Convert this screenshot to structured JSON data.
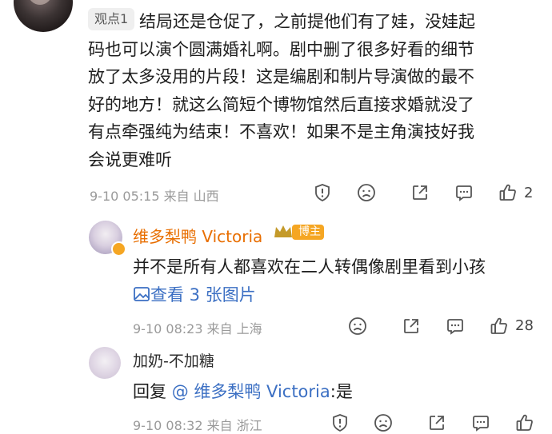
{
  "comment": {
    "badge": "观点1",
    "text": "结局还是仓促了，之前提他们有了娃，没娃起码也可以演个圆满婚礼啊。剧中删了很多好看的细节放了太多没用的片段！这是编剧和制片导演做的最不好的地方！就这么简短个博物馆然后直接求婚就没了有点牵强纯为结束！不喜欢！如果不是主角演技好我会说更难听",
    "lines": [
      "结局还是仓促了，之前提他们有了娃，没娃起",
      "码也可以演个圆满婚礼啊。剧中删了很多好看的细节",
      "放了太多没用的片段！这是编剧和制片导演做的最不",
      "好的地方！就这么简短个博物馆然后直接求婚就没了",
      "有点牵强纯为结束！不喜欢！如果不是主角演技好我",
      "会说更难听"
    ],
    "meta": "9-10 05:15  来自 山西",
    "like_count": "2"
  },
  "replies": [
    {
      "username": "维多梨鸭 Victoria",
      "role_badge": "博主",
      "text": "并不是所有人都喜欢在二人转偶像剧里看到小孩",
      "view_images": "查看 3 张图片",
      "meta": "9-10 08:23  来自 上海",
      "like_count": "28"
    },
    {
      "username": "加奶-不加糖",
      "text_prefix": "回复 ",
      "mention": "@ 维多梨鸭 Victoria",
      "text_suffix": ":是",
      "meta": "9-10 08:32  来自 浙江"
    }
  ],
  "icons": [
    "report-icon",
    "dislike-icon",
    "share-icon",
    "comment-icon",
    "like-icon",
    "image-icon"
  ],
  "colors": {
    "username": "#e86e00",
    "link": "#3b6fc3",
    "meta": "#9a9a9a",
    "badge_bg": "#efefef"
  }
}
